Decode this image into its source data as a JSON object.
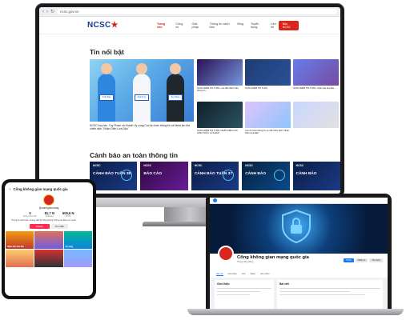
{
  "monitor": {
    "url": "ncsc.gov.vn",
    "logo": "NCSC",
    "menu": [
      "Trang chủ",
      "Công cụ",
      "Giải pháp",
      "Thông tin cảnh báo",
      "Blog",
      "Tuyển dụng",
      "Liên hệ"
    ],
    "header_button": "Báo NCSC",
    "news_title": "Tin nổi bật",
    "feature_caption": "NCSC hợp tác, Tuy Phạm và Khánh Vy cùng Cục An toàn thông tin và Meta lan tỏa chiến dịch \"Nhận Diện Lừa Đảo\"",
    "feature_signs": [
      "Tuấn Bảo",
      "Khánh Vy",
      "Tuy Phạm"
    ],
    "small_captions": [
      "NCSC ĐIỂM TIN TUẦN: Lừa đảo đánh tráo thông tin...",
      "NCSC ĐIỂM TIN TUẦN",
      "NCSC ĐIỂM TIN TUẦN: Cảnh báo lừa đảo...",
      "NCSC ĐIỂM TIN TUẦN: NHẬN DIỆN CÁC HÌNH THỨC LỪA ĐẢO",
      "Cục An toàn thông tin ra mắt chiến dịch \"Nhận Diện Lừa Đảo\"",
      ""
    ],
    "warnings_title": "Cảnh báo an toàn thông tin",
    "warning_cards": [
      {
        "brand": "NCSC",
        "text": "CẢNH BÁO TUẦN 38"
      },
      {
        "brand": "NCSC",
        "text": "BÁO CÁO"
      },
      {
        "brand": "NCSC",
        "text": "CẢNH BÁO TUẦN 37"
      },
      {
        "brand": "NCSC",
        "text": "CẢNH BÁO"
      },
      {
        "brand": "NCSC",
        "text": "CẢNH BÁO"
      }
    ]
  },
  "tablet": {
    "title": "Cổng không gian mạng quốc gia",
    "handle": "@canhgiacmang",
    "stats": [
      {
        "num": "0",
        "label": "Đang theo dõi"
      },
      {
        "num": "81,7 N",
        "label": "Follower"
      },
      {
        "num": "605,6 N",
        "label": "Thích"
      }
    ],
    "bio": "Thông tin cảnh báo, hướng dẫn kỹ năng phòng chống lừa đảo trực tuyến",
    "follow_label": "Follow",
    "message_label": "Tin nhắn",
    "pins": [
      "Nhận diện lừa đảo",
      "",
      "Kỹ năng",
      "",
      "",
      ""
    ]
  },
  "laptop": {
    "page_name": "Cổng không gian mạng quốc gia",
    "page_sub": "Trang cộng đồng",
    "buttons": [
      "Thích",
      "Nhắn tin",
      "Tìm kiếm"
    ],
    "tabs": [
      "Bài viết",
      "Giới thiệu",
      "Ảnh",
      "Video",
      "Xem thêm"
    ],
    "intro_title": "Giới thiệu",
    "feed_title": "Bài viết"
  },
  "colors": {
    "brand_red": "#d7261e",
    "brand_blue": "#1a3a8f",
    "facebook_blue": "#1877f2",
    "tiktok_pink": "#fe2c55"
  }
}
